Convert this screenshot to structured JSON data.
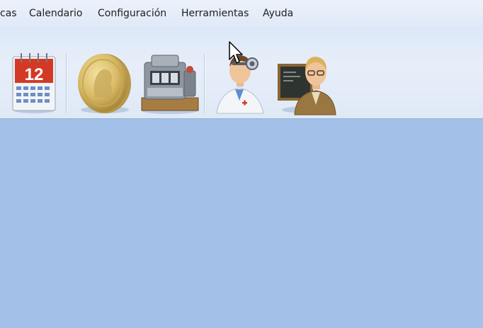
{
  "menu": {
    "items": [
      {
        "label": "cas"
      },
      {
        "label": "Calendario"
      },
      {
        "label": "Configuración"
      },
      {
        "label": "Herramientas"
      },
      {
        "label": "Ayuda"
      }
    ]
  },
  "toolbar": {
    "calendar": {
      "icon": "calendar-icon",
      "day": "12"
    },
    "coin": {
      "icon": "gold-coin-icon"
    },
    "register": {
      "icon": "cash-register-icon"
    },
    "doctor": {
      "icon": "doctor-icon"
    },
    "teacher": {
      "icon": "teacher-icon"
    }
  },
  "colors": {
    "menubar": "#e6eef9",
    "toolbar": "#e0eaf7",
    "workspace": "#a3c1e8",
    "accent_red": "#d23a25"
  }
}
